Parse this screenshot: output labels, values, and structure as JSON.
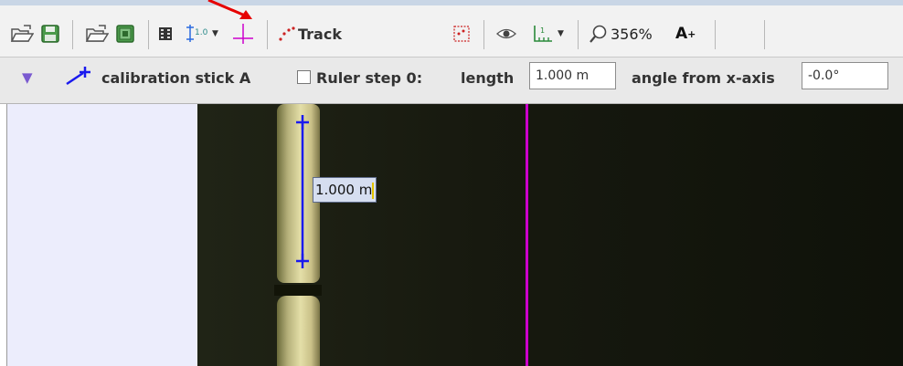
{
  "toolbar": {
    "track_label": "Track",
    "zoom_value": "356%",
    "font_button_label": "A",
    "font_button_sup": "+",
    "icons": [
      "open-folder-icon",
      "save-icon",
      "open-video-icon",
      "save-video-icon",
      "film-icon",
      "calibration-tool-icon",
      "dropdown-arrow-icon",
      "coordinate-axes-icon",
      "track-points-icon",
      "track-control-icon",
      "visibility-eye-icon",
      "ruler-grid-icon",
      "zoom-magnifier-icon"
    ]
  },
  "trackbar": {
    "track_name": "calibration stick A",
    "ruler_checkbox_checked": false,
    "step_label": "Ruler step 0:",
    "length_label": "length",
    "length_value": "1.000 m",
    "angle_label": "angle from x-axis",
    "angle_value": "-0.0°"
  },
  "viewer": {
    "readout_value": "1.000 m"
  },
  "colors": {
    "calibration": "#1a1aee",
    "axis": "#cc00cc",
    "annotation_arrow": "#e60000"
  }
}
